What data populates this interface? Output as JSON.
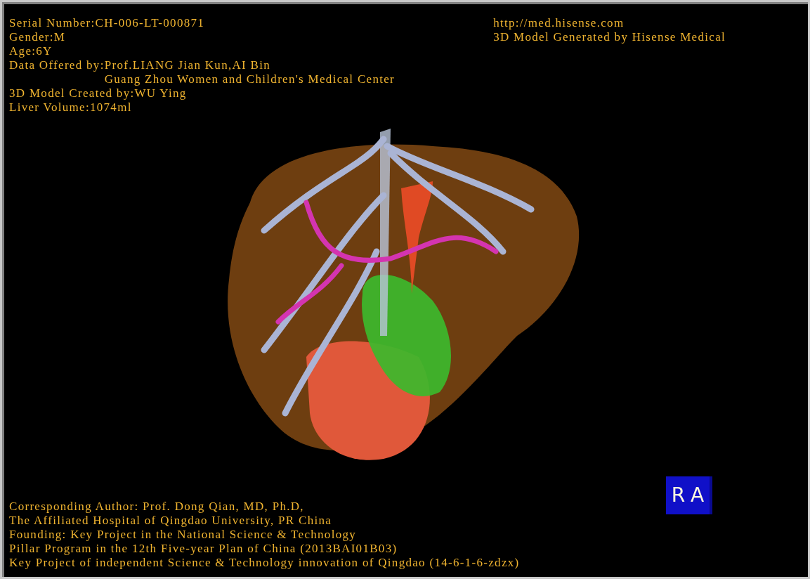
{
  "patient_info": [
    {
      "label": "Serial Number:",
      "values": [
        "CH-006-LT-000871"
      ]
    },
    {
      "label": "Gender:",
      "values": [
        "M"
      ]
    },
    {
      "label": "Age:",
      "values": [
        "6Y"
      ]
    },
    {
      "label": "Data Offered by:",
      "values": [
        "Prof.LIANG Jian Kun,AI Bin",
        "Guang Zhou Women and Children's Medical Center"
      ]
    },
    {
      "label": "3D Model Created by:",
      "values": [
        "WU Ying"
      ]
    },
    {
      "label": "Liver Volume:",
      "values": [
        "1074ml"
      ]
    }
  ],
  "vendor_info": [
    "http://med.hisense.com",
    "3D Model Generated by Hisense Medical"
  ],
  "orientation_cube": {
    "labels": [
      "R",
      "A"
    ]
  },
  "credits": [
    "Corresponding Author: Prof. Dong Qian, MD, Ph.D,",
    "The Affiliated Hospital of Qingdao University, PR China",
    "Founding: Key Project in the National Science & Technology",
    "Pillar Program in the 12th Five-year Plan of China (2013BAI01B03)",
    "Key Project of independent Science & Technology innovation of Qingdao (14-6-1-6-zdzx)"
  ]
}
